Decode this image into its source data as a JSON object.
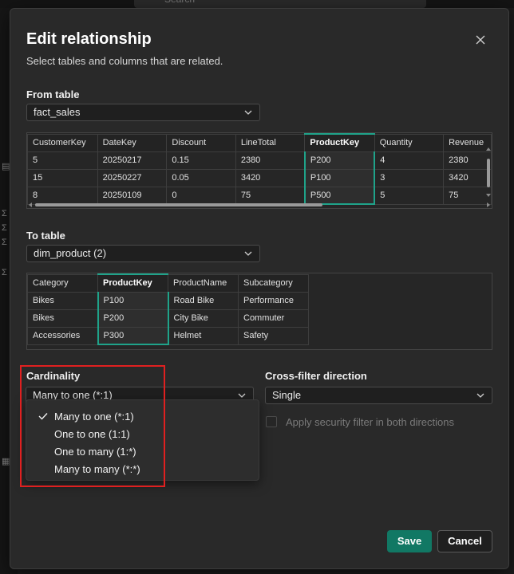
{
  "background": {
    "search_placeholder": "Search"
  },
  "dialog": {
    "title": "Edit relationship",
    "subtitle": "Select tables and columns that are related.",
    "from_table": {
      "label": "From table",
      "selected": "fact_sales",
      "columns": [
        "CustomerKey",
        "DateKey",
        "Discount",
        "LineTotal",
        "ProductKey",
        "Quantity",
        "Revenue"
      ],
      "selected_column": "ProductKey",
      "rows": [
        [
          "5",
          "20250217",
          "0.15",
          "2380",
          "P200",
          "4",
          "2380"
        ],
        [
          "15",
          "20250227",
          "0.05",
          "3420",
          "P100",
          "3",
          "3420"
        ],
        [
          "8",
          "20250109",
          "0",
          "75",
          "P500",
          "5",
          "75"
        ]
      ]
    },
    "to_table": {
      "label": "To table",
      "selected": "dim_product (2)",
      "columns": [
        "Category",
        "ProductKey",
        "ProductName",
        "Subcategory"
      ],
      "selected_column": "ProductKey",
      "rows": [
        [
          "Bikes",
          "P100",
          "Road Bike",
          "Performance"
        ],
        [
          "Bikes",
          "P200",
          "City Bike",
          "Commuter"
        ],
        [
          "Accessories",
          "P300",
          "Helmet",
          "Safety"
        ]
      ]
    },
    "cardinality": {
      "label": "Cardinality",
      "selected": "Many to one (*:1)",
      "options": [
        "Many to one (*:1)",
        "One to one (1:1)",
        "One to many (1:*)",
        "Many to many (*:*)"
      ]
    },
    "cross_filter": {
      "label": "Cross-filter direction",
      "selected": "Single",
      "security_filter_label": "Apply security filter in both directions"
    },
    "buttons": {
      "save": "Save",
      "cancel": "Cancel"
    },
    "colors": {
      "accent": "#1fa38a",
      "primary_button": "#117864",
      "highlight_box": "#e02020"
    }
  }
}
